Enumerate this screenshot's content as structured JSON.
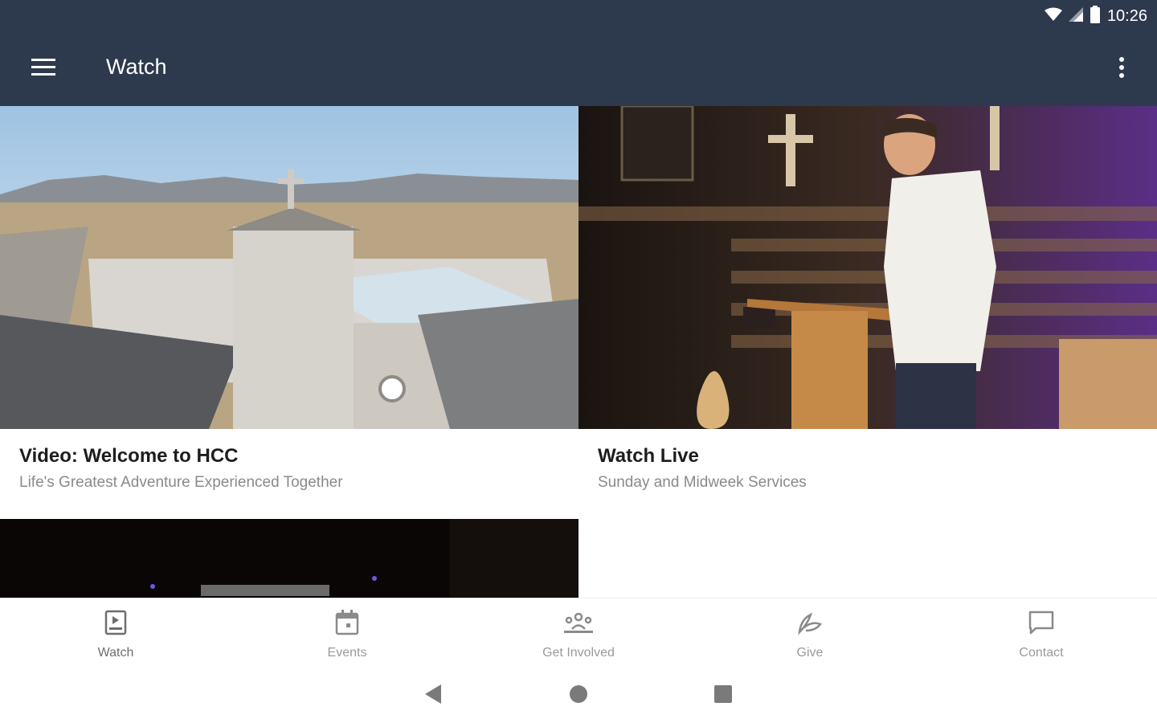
{
  "status_bar": {
    "time": "10:26"
  },
  "app_bar": {
    "title": "Watch"
  },
  "cards": [
    {
      "title": "Video: Welcome to HCC",
      "subtitle": "Life's Greatest Adventure Experienced Together"
    },
    {
      "title": "Watch Live",
      "subtitle": "Sunday and Midweek Services"
    }
  ],
  "bottom_nav": [
    {
      "label": "Watch",
      "icon": "watch-icon",
      "active": true
    },
    {
      "label": "Events",
      "icon": "calendar-icon",
      "active": false
    },
    {
      "label": "Get Involved",
      "icon": "group-icon",
      "active": false
    },
    {
      "label": "Give",
      "icon": "give-icon",
      "active": false
    },
    {
      "label": "Contact",
      "icon": "chat-icon",
      "active": false
    }
  ],
  "colors": {
    "app_bar": "#2d3a4e",
    "nav_text": "#9a9a9a",
    "title_text": "#1d1d1d",
    "subtitle_text": "#8a8a8a"
  }
}
